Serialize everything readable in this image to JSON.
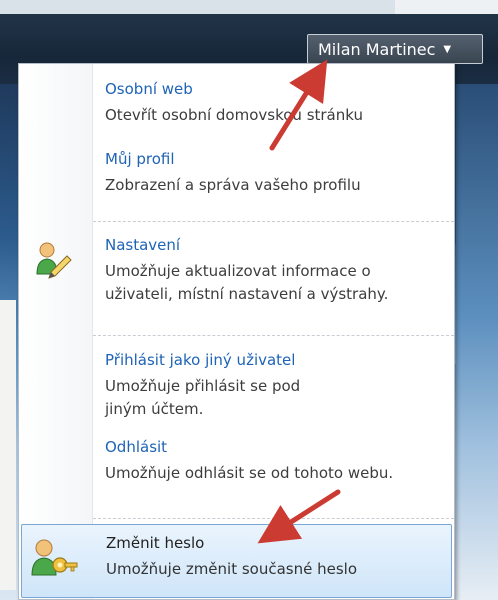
{
  "user_button": {
    "name": "Milan Martinec"
  },
  "menu": {
    "items": [
      {
        "title": "Osobní web",
        "desc": "Otevřít osobní domovskou stránku"
      },
      {
        "title": "Můj profil",
        "desc": "Zobrazení a správa vašeho profilu"
      },
      {
        "title": "Nastavení",
        "desc": "Umožňuje aktualizovat informace o uživateli, místní nastavení a výstrahy."
      },
      {
        "title": "Přihlásit jako jiný uživatel",
        "desc": "Umožňuje přihlásit se pod jiným účtem."
      },
      {
        "title": "Odhlásit",
        "desc": "Umožňuje odhlásit se od tohoto webu."
      },
      {
        "title": "Změnit heslo",
        "desc": "Umožňuje změnit současné heslo"
      }
    ]
  },
  "icons": {
    "user_button_caret": "caret-down-icon",
    "settings": "user-edit-icon",
    "change_password": "user-key-icon"
  },
  "colors": {
    "link": "#1e63b6",
    "arrow": "#cc3b32",
    "selected_bg": "#d6e9fb",
    "ribbon": "#1b2d42"
  }
}
